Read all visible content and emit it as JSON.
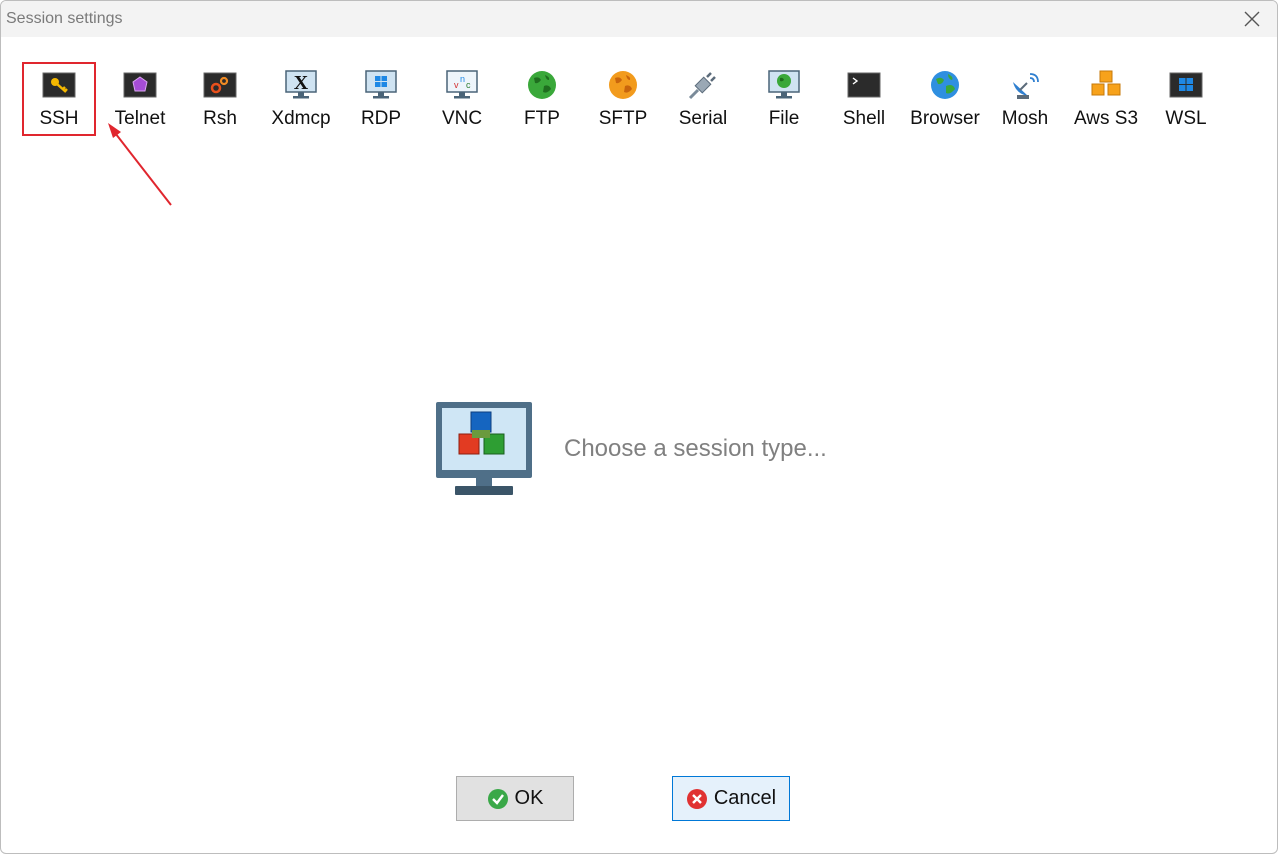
{
  "window": {
    "title": "Session settings"
  },
  "toolbar": {
    "items": [
      {
        "label": "SSH",
        "icon": "key-terminal-icon"
      },
      {
        "label": "Telnet",
        "icon": "purple-gem-terminal-icon"
      },
      {
        "label": "Rsh",
        "icon": "gears-terminal-icon"
      },
      {
        "label": "Xdmcp",
        "icon": "x-monitor-icon"
      },
      {
        "label": "RDP",
        "icon": "windows-monitor-icon"
      },
      {
        "label": "VNC",
        "icon": "vnc-monitor-icon"
      },
      {
        "label": "FTP",
        "icon": "green-globe-icon"
      },
      {
        "label": "SFTP",
        "icon": "orange-globe-icon"
      },
      {
        "label": "Serial",
        "icon": "serial-plug-icon"
      },
      {
        "label": "File",
        "icon": "globe-monitor-icon"
      },
      {
        "label": "Shell",
        "icon": "shell-terminal-icon"
      },
      {
        "label": "Browser",
        "icon": "browser-globe-icon"
      },
      {
        "label": "Mosh",
        "icon": "satellite-dish-icon"
      },
      {
        "label": "Aws S3",
        "icon": "aws-cubes-icon"
      },
      {
        "label": "WSL",
        "icon": "wsl-windows-icon"
      }
    ],
    "selected": "SSH"
  },
  "main": {
    "hint": "Choose a session type..."
  },
  "buttons": {
    "ok_label": "OK",
    "cancel_label": "Cancel"
  },
  "colors": {
    "highlight": "#e0262e",
    "hint": "#808080"
  }
}
